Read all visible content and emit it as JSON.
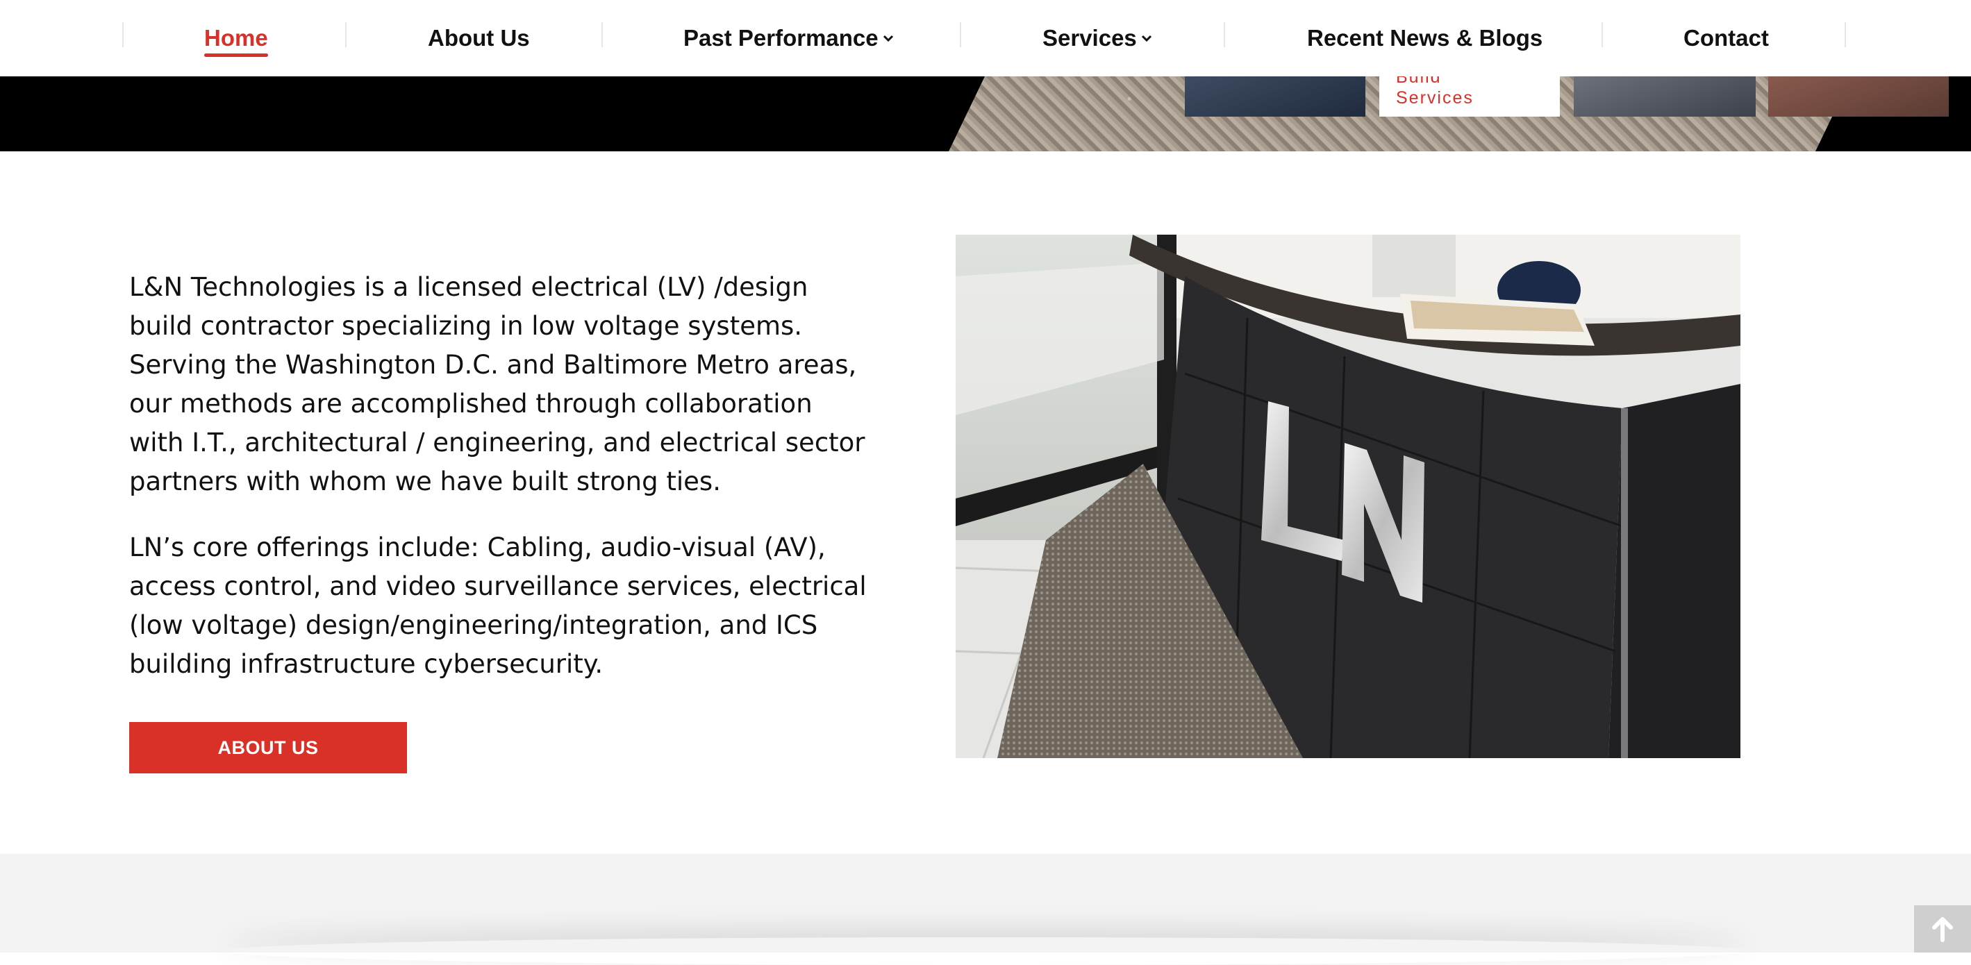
{
  "nav": {
    "items": [
      {
        "label": "Home",
        "active": true
      },
      {
        "label": "About Us",
        "active": false
      },
      {
        "label": "Past Performance",
        "active": false,
        "dropdown": true
      },
      {
        "label": "Services",
        "active": false,
        "dropdown": true
      },
      {
        "label": "Recent News & Blogs",
        "active": false
      },
      {
        "label": "Contact",
        "active": false
      }
    ]
  },
  "hero": {
    "tile_label": "Build\nServices"
  },
  "intro": {
    "paragraph1": "L&N Technologies is a licensed electrical (LV) /design build contractor specializing in low voltage systems. Serving the Washington D.C. and Baltimore Metro areas, our methods are accomplished through collaboration with I.T., architectural / engineering, and electrical sector partners with whom we have built strong ties.",
    "paragraph2": "LN’s core offerings include: Cabling, audio-visual (AV), access control, and video surveillance services, electrical (low voltage) design/engineering/integration, and ICS building infrastructure cybersecurity.",
    "button_label": "ABOUT US"
  },
  "photo": {
    "sign_text": "LN"
  },
  "icons": {
    "chevron": "chevron-down-icon",
    "scroll_top": "arrow-up-icon"
  },
  "colors": {
    "accent": "#d93128",
    "text": "#111111",
    "band": "#f3f3f3"
  }
}
